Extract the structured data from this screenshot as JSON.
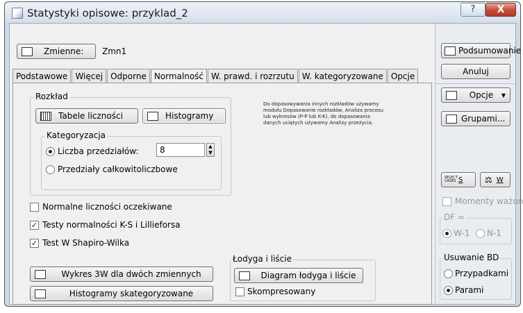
{
  "window": {
    "title": "Statystyki opisowe: przyklad_2",
    "help_label": "?",
    "close_label": "X"
  },
  "variables": {
    "button_label": "Zmienne:",
    "value": "Zmn1"
  },
  "tabs": [
    {
      "label": "Podstawowe"
    },
    {
      "label": "Więcej"
    },
    {
      "label": "Odporne"
    },
    {
      "label": "Normalność"
    },
    {
      "label": "W. prawd. i rozrzutu"
    },
    {
      "label": "W. kategoryzowane"
    },
    {
      "label": "Opcje"
    }
  ],
  "active_tab": "Normalność",
  "distribution": {
    "group_title": "Rozkład",
    "freq_tables_label": "Tabele liczności",
    "histograms_label": "Histogramy",
    "info_text": "Do dopasowywania innych rozkładów używamy modułu Dopasowanie rozkładów, Analiza procesu lub wykresów (P-P lub K-K), do dopasowania danych uciętych używamy Analizy przeżycia.",
    "categorization": {
      "title": "Kategoryzacja",
      "num_intervals_label": "Liczba przedziałów:",
      "num_intervals_value": "8",
      "integer_intervals_label": "Przedziały całkowitoliczbowe",
      "selected": "num_intervals"
    }
  },
  "options": {
    "expected_normal_label": "Normalne liczności oczekiwane",
    "expected_normal_checked": false,
    "ks_lilliefors_label": "Testy normalności  K-S i Lillieforsa",
    "ks_lilliefors_checked": true,
    "shapiro_wilk_label": "Test W Shapiro-Wilka",
    "shapiro_wilk_checked": true
  },
  "plots": {
    "plot3d_label": "Wykres 3W  dla dwóch zmiennych",
    "cat_histograms_label": "Histogramy skategoryzowane"
  },
  "stem_leaf": {
    "group_title": "Łodyga i liście",
    "diagram_label": "Diagram łodyga i liście",
    "compressed_label": "Skompresowany",
    "compressed_checked": false
  },
  "sidebar": {
    "summary_label": "Podsumowanie",
    "cancel_label": "Anuluj",
    "options_label": "Opcje",
    "by_group_label": "Grupami...",
    "select_cases_icon_text": "SELECT CASES",
    "s_label": "S",
    "w_label": "W",
    "weighted_moments_label": "Momenty ważone",
    "weighted_moments_checked": false,
    "df_label": "DF =",
    "df_options": [
      "W-1",
      "N-1"
    ],
    "df_selected": "W-1",
    "missing_title": "Usuwanie BD",
    "missing_options": [
      "Przypadkami",
      "Parami"
    ],
    "missing_selected": "Parami"
  }
}
